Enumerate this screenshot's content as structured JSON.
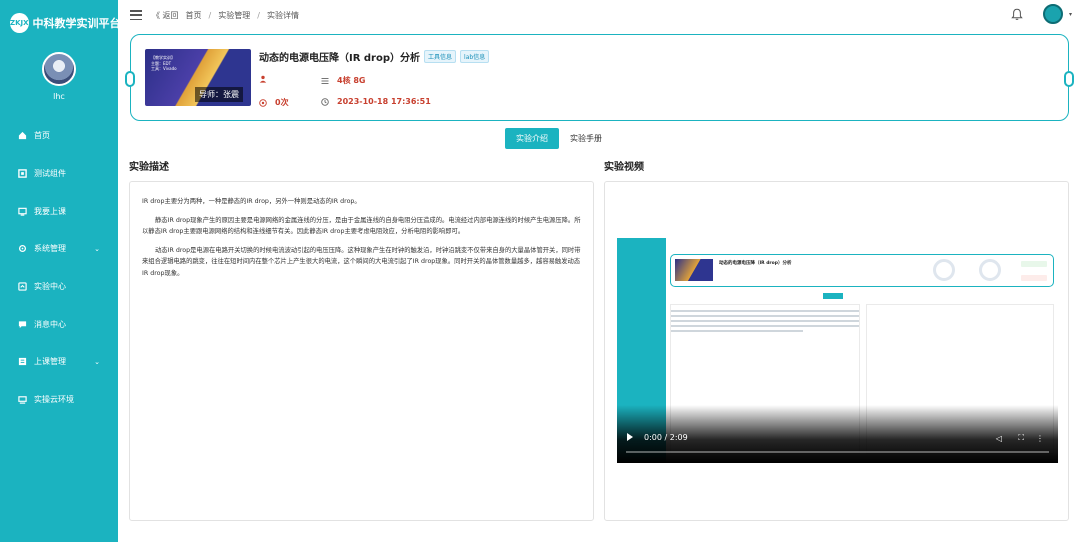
{
  "app": {
    "brand_title": "中科教学实训平台",
    "brand_logo_text": "ZKJX"
  },
  "sidebar": {
    "username": "lhc",
    "items": [
      {
        "label": "首页",
        "icon": "home-icon",
        "has_caret": false
      },
      {
        "label": "测试组件",
        "icon": "component-icon",
        "has_caret": false
      },
      {
        "label": "我要上课",
        "icon": "class-icon",
        "has_caret": false
      },
      {
        "label": "系统管理",
        "icon": "settings-icon",
        "has_caret": true
      },
      {
        "label": "实验中心",
        "icon": "experiment-icon",
        "has_caret": false
      },
      {
        "label": "消息中心",
        "icon": "message-icon",
        "has_caret": false
      },
      {
        "label": "上课管理",
        "icon": "course-manage-icon",
        "has_caret": true
      },
      {
        "label": "实操云环境",
        "icon": "cloud-icon",
        "has_caret": false
      }
    ]
  },
  "header": {
    "back_label": "《 返回",
    "breadcrumbs": [
      "首页",
      "实验管理",
      "实验详情"
    ],
    "separator": "/"
  },
  "course": {
    "title": "动态的电源电压降（IR drop）分析",
    "tags": [
      "工具信息",
      "lab信息"
    ],
    "thumbnail_text": "导师：张震",
    "thumbnail_lines": [
      "【教学实训】",
      "主题：EDT",
      "工具：Vivado"
    ],
    "resources": "4核 8G",
    "count": "0次",
    "datetime": "2023-10-18 17:36:51",
    "teacher_value": ""
  },
  "tabs": [
    {
      "label": "实验介绍",
      "active": true
    },
    {
      "label": "实验手册",
      "active": false
    }
  ],
  "description": {
    "heading": "实验描述",
    "paragraphs": [
      "IR drop主要分为两种，一种是静态的IR drop，另外一种则是动态的IR drop。",
      "静态IR drop现象产生的原因主要是电源网络的金属连线的分压，是由于金属连线的自身电阻分压造成的。电流经过内部电源连线的时候产生电源压降。所以静态IR drop主要跟电源网络的结构和连线细节有关。因此静态IR drop主要考虑电阻效应，分析电阻的影响即可。",
      "动态IR drop是电源在电路开关切换的时候电流波动引起的电压压降。这种现象产生在时钟的触发沿，时钟沿跳变不仅带来自身的大量晶体管开关，同时带来组合逻辑电路的跳变，往往在短时间内在整个芯片上产生很大的电流，这个瞬间的大电流引起了IR drop现象。同时开关的晶体管数量越多，越容易触发动态IR drop现象。"
    ]
  },
  "video": {
    "heading": "实验视频",
    "time": "0:00 / 2:09",
    "progress": 0,
    "mini_title": "动态的电源电压降（IR drop）分析"
  },
  "colors": {
    "accent": "#1bb3c0",
    "value_red": "#c8402f"
  }
}
